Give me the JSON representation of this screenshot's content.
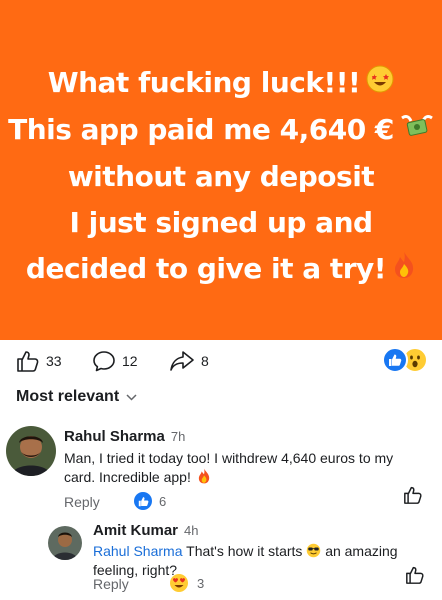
{
  "post": {
    "lines": [
      "What fucking luck!!!",
      "This app paid me 4,640 €",
      "without any deposit",
      "I just signed up and",
      "decided to give it a try!"
    ],
    "colors": {
      "background": "#ff6a13",
      "text": "#ffffff"
    }
  },
  "actions": {
    "like_count": "33",
    "comment_count": "12",
    "share_count": "8",
    "reactions": [
      "like-icon",
      "wow-icon"
    ]
  },
  "comments_header": {
    "sort_label": "Most relevant"
  },
  "comments": [
    {
      "name": "Rahul Sharma",
      "time": "7h",
      "text": "Man, I tried it today too! I withdrew 4,640 euros to my card. Incredible app!",
      "reply_label": "Reply",
      "reaction_count": "6"
    }
  ],
  "reply": {
    "name": "Amit Kumar",
    "time": "4h",
    "mention": "Rahul Sharma",
    "text_before_emoji": "That's how it starts",
    "text_after_emoji": "an amazing feeling, right?",
    "reply_label": "Reply",
    "reaction_count": "3"
  }
}
